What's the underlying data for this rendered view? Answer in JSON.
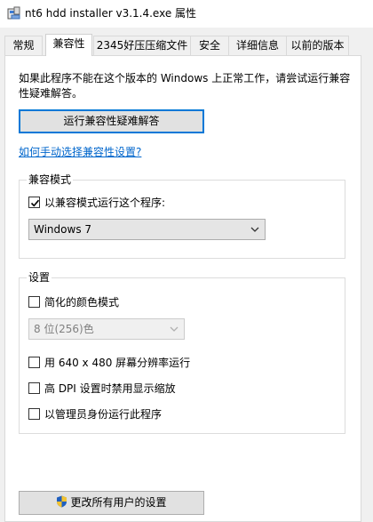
{
  "window": {
    "title": "nt6 hdd installer v3.1.4.exe 属性",
    "icon": "installer-icon"
  },
  "tabs": [
    {
      "label": "常规",
      "active": false
    },
    {
      "label": "兼容性",
      "active": true
    },
    {
      "label": "2345好压压缩文件",
      "active": false
    },
    {
      "label": "安全",
      "active": false
    },
    {
      "label": "详细信息",
      "active": false
    },
    {
      "label": "以前的版本",
      "active": false
    }
  ],
  "compat": {
    "description": "如果此程序不能在这个版本的 Windows 上正常工作，请尝试运行兼容性疑难解答。",
    "troubleshoot_button": "运行兼容性疑难解答",
    "manual_link": "如何手动选择兼容性设置?",
    "mode_group": {
      "label": "兼容模式",
      "checkbox_label": "以兼容模式运行这个程序:",
      "checked": true,
      "selected_os": "Windows 7"
    },
    "settings_group": {
      "label": "设置",
      "reduced_color": {
        "label": "简化的颜色模式",
        "checked": false
      },
      "color_select": "8 位(256)色",
      "res_640": {
        "label": "用 640 x 480 屏幕分辨率运行",
        "checked": false
      },
      "high_dpi": {
        "label": "高 DPI 设置时禁用显示缩放",
        "checked": false
      },
      "run_admin": {
        "label": "以管理员身份运行此程序",
        "checked": false
      }
    },
    "all_users_button": "更改所有用户的设置"
  },
  "colors": {
    "accent": "#0078d7",
    "link": "#0066cc"
  }
}
